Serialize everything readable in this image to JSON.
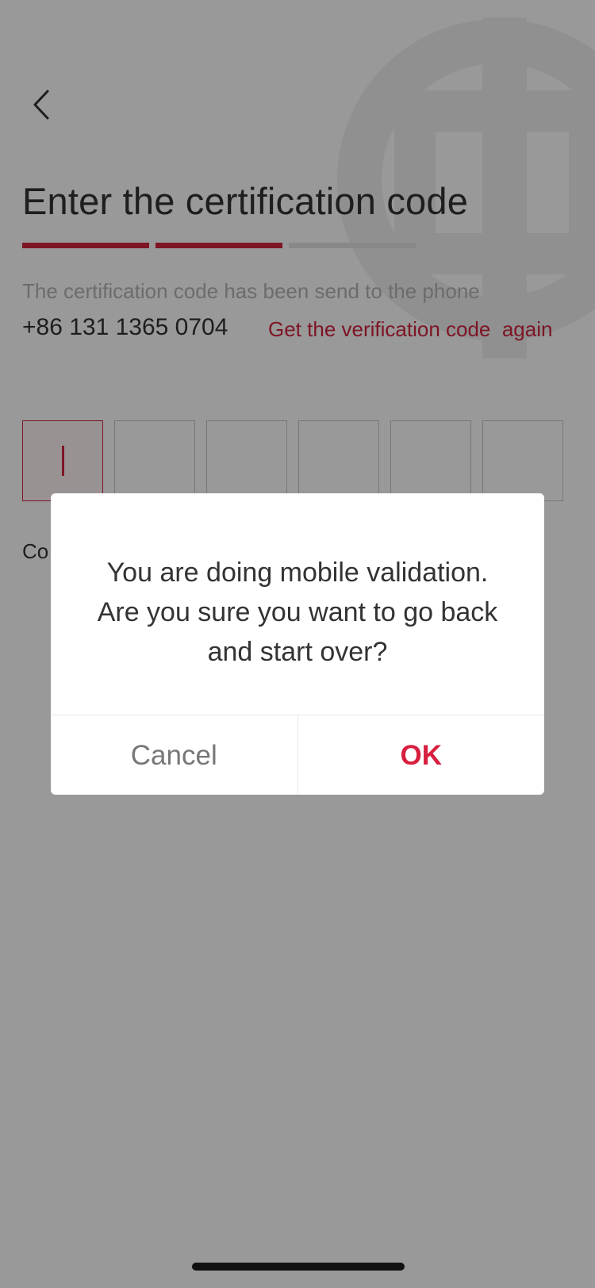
{
  "header": {
    "back_icon": "chevron-left-icon",
    "title": "Enter the certification code"
  },
  "progress": {
    "total_steps": 3,
    "completed_steps": 2,
    "active_color": "#d0233f",
    "inactive_color": "#e3e3e3"
  },
  "info": {
    "message": "The certification code has been send to the phone",
    "phone": "+86 131 1365 0704",
    "resend_link": "Get the verification code  again"
  },
  "code_input": {
    "box_count": 6,
    "filled": [
      "",
      "",
      "",
      "",
      "",
      ""
    ]
  },
  "below_code": {
    "partial_label": "Co"
  },
  "dialog": {
    "message_line1": "You are doing mobile validation.",
    "message_line2": "Are you sure you want to go back",
    "message_line3": "and start over?",
    "cancel_label": "Cancel",
    "ok_label": "OK",
    "ok_color": "#d81e3f"
  },
  "watermark_icon": "bank-logo-watermark"
}
